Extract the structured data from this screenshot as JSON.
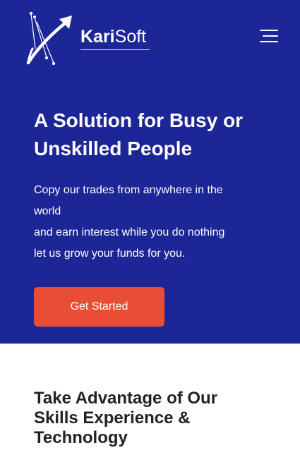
{
  "header": {
    "logo_bold": "Kari",
    "logo_light": "Soft",
    "logo_icon": "arrow-swoosh-icon",
    "menu_icon": "hamburger-menu-icon"
  },
  "hero": {
    "title": "A Solution for Busy or Unskilled People",
    "lines": [
      "Copy our trades from anywhere in the world",
      "and earn interest while you do nothing",
      "let us grow your funds for you."
    ],
    "cta_label": "Get Started"
  },
  "section": {
    "title": "Take Advantage of Our Skills Experience & Technology"
  },
  "colors": {
    "hero_bg": "#1c2696",
    "cta_bg": "#ea4d36",
    "text_dark": "#222222",
    "white": "#ffffff"
  }
}
